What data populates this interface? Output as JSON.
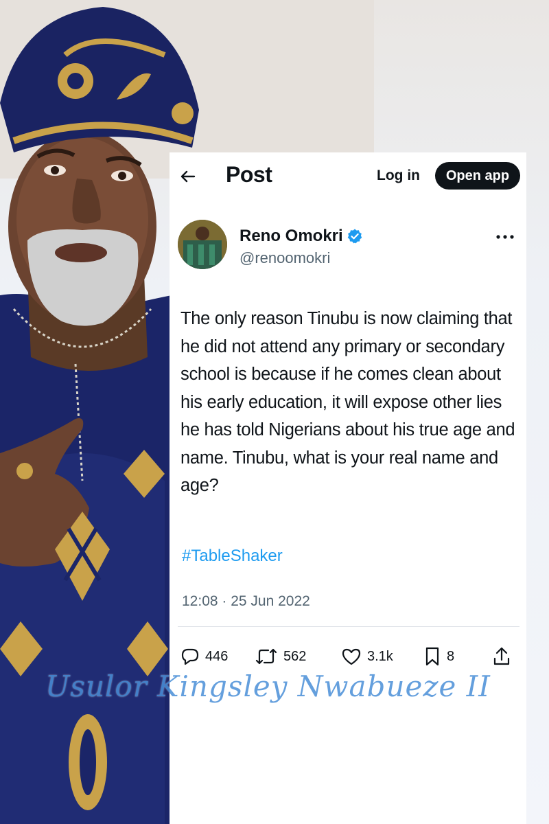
{
  "header": {
    "back_icon": "arrow-left-icon",
    "title": "Post",
    "login_label": "Log in",
    "open_app_label": "Open app"
  },
  "post": {
    "author_name": "Reno Omokri",
    "author_handle": "@renoomokri",
    "verified": true,
    "more_icon": "more-dots-icon",
    "text": "The only reason Tinubu is now claiming that he did not attend any primary or secondary school is because if he comes clean about his early education, it will expose other lies he has told Nigerians about his true age and name. Tinubu, what is your real name and age?",
    "hashtag": "#TableShaker",
    "timestamp": "12:08 · 25 Jun 2022"
  },
  "actions": {
    "replies": "446",
    "reposts": "562",
    "likes": "3.1k",
    "bookmarks": "8"
  },
  "watermark": "Usulor Kingsley Nwabueze II",
  "colors": {
    "accent": "#1d9bf0",
    "text": "#0f1419",
    "secondary": "#536471",
    "agbada_blue": "#1a2466",
    "embroidery_gold": "#c9a24a"
  }
}
